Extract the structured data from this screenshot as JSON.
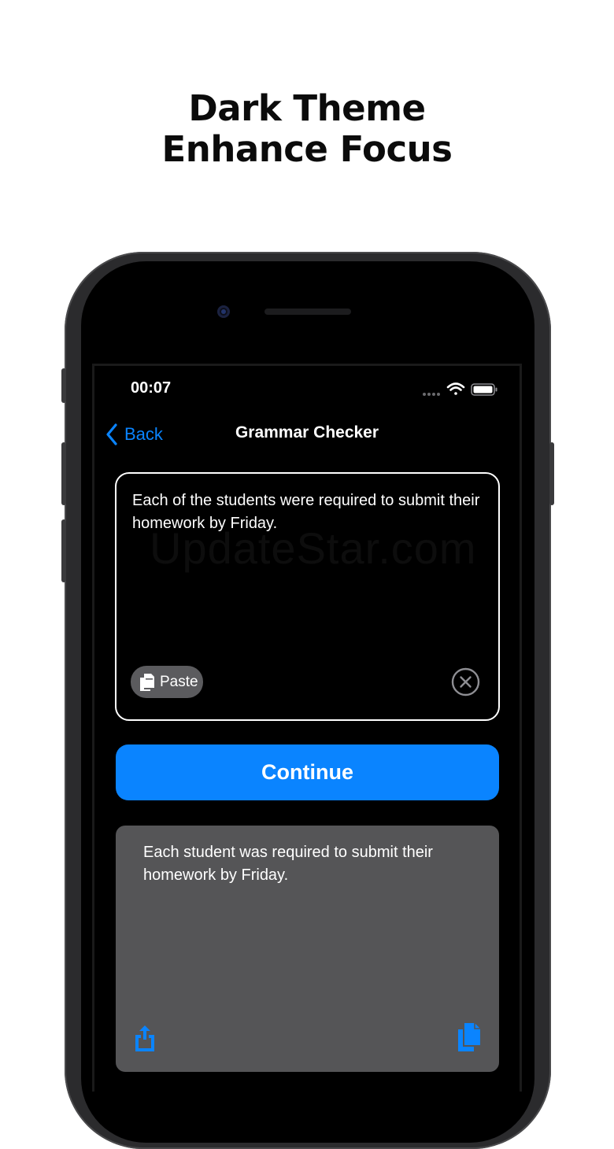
{
  "headline": {
    "line1": "Dark Theme",
    "line2": "Enhance Focus"
  },
  "status_bar": {
    "time": "00:07",
    "icons": [
      "signal-dots-icon",
      "wifi-icon",
      "battery-icon"
    ]
  },
  "nav": {
    "back_label": "Back",
    "title": "Grammar Checker"
  },
  "input": {
    "text": "Each of the students were required to submit their homework by Friday.",
    "paste_label": "Paste",
    "watermark": "UpdateStar.com"
  },
  "continue_label": "Continue",
  "result": {
    "text": "Each student was required to submit their homework by Friday."
  },
  "colors": {
    "accent": "#0a84ff",
    "background": "#000000",
    "result_card": "#555557",
    "paste_button": "#5b5b5e"
  }
}
